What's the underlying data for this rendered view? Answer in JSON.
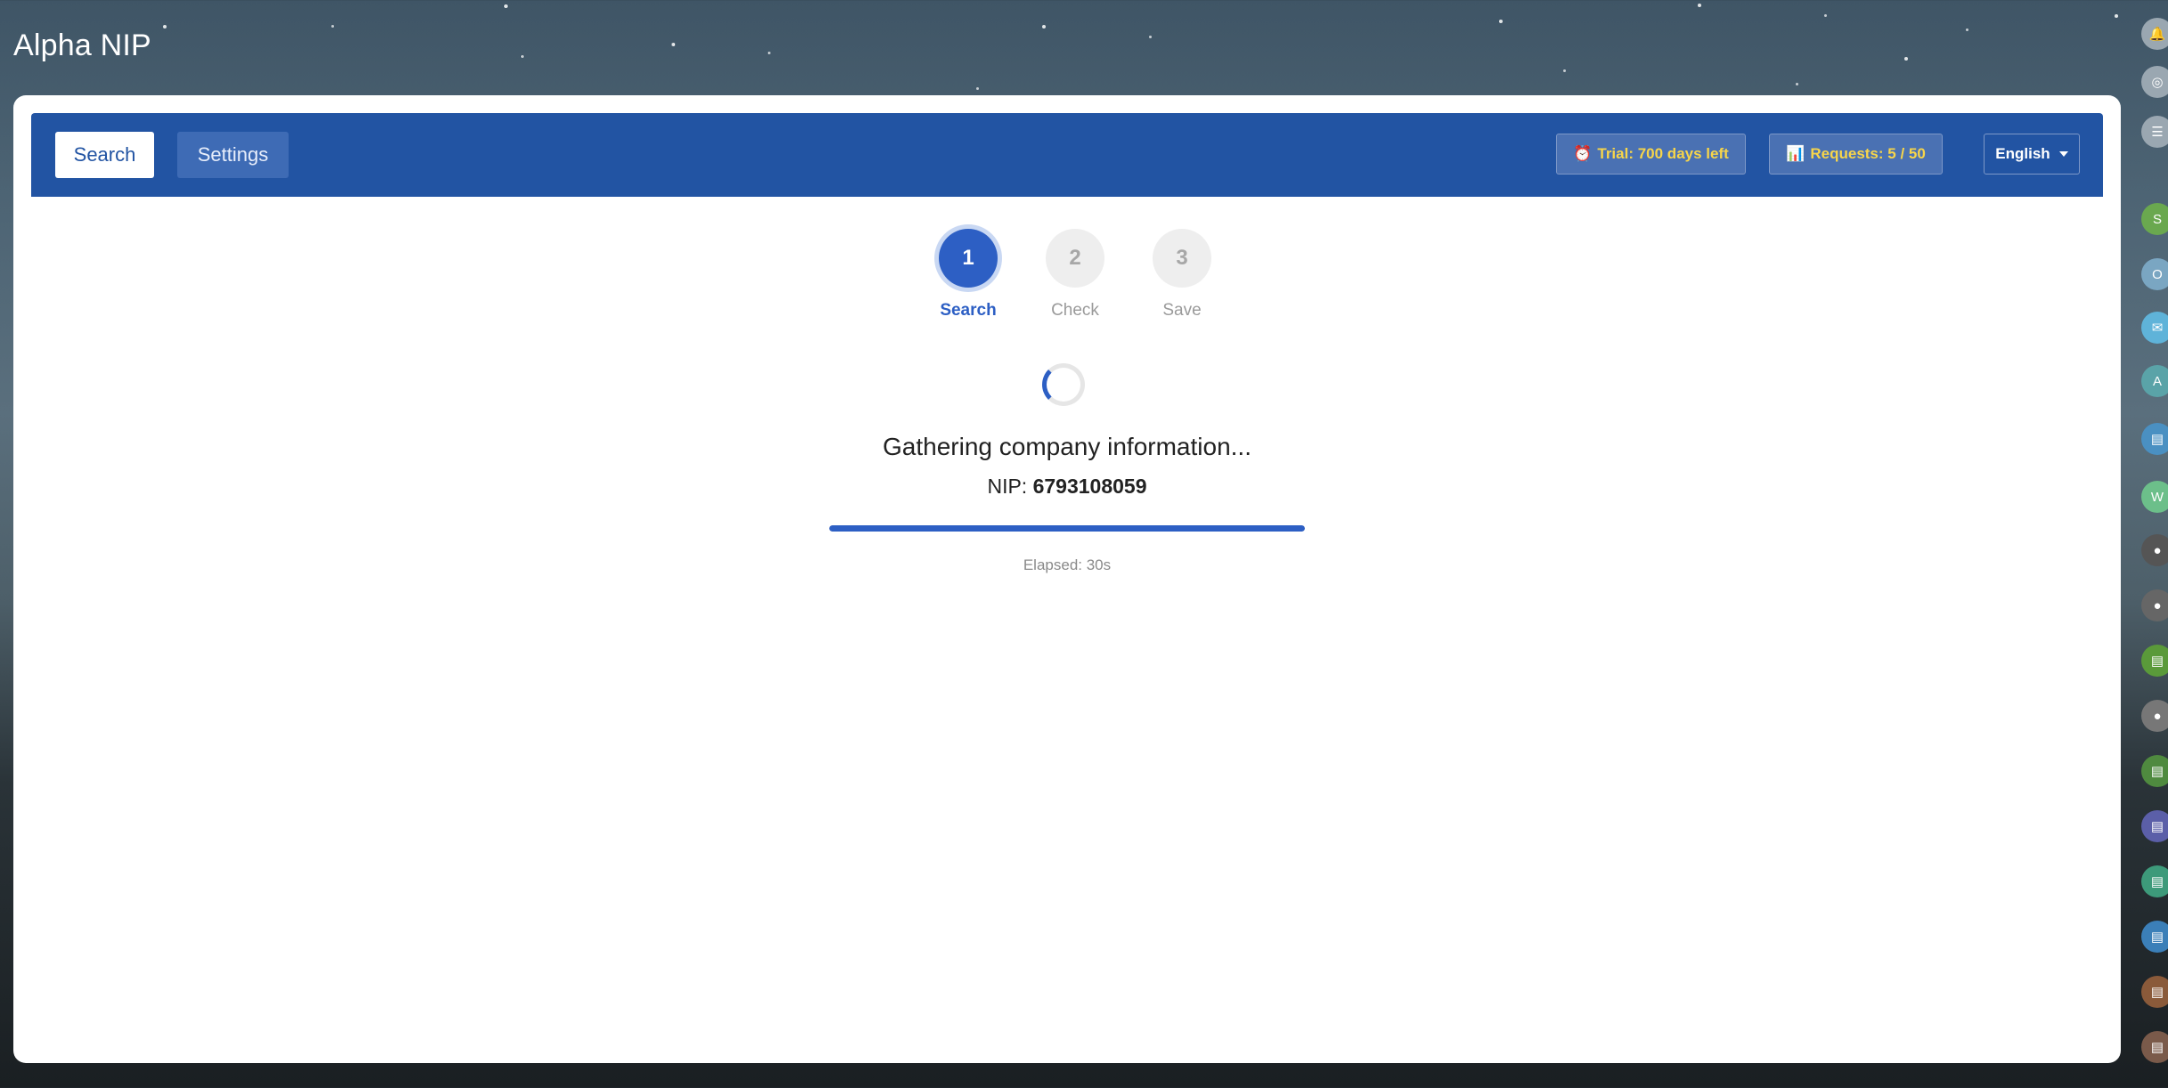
{
  "app": {
    "title": "Alpha NIP"
  },
  "tabs": [
    {
      "label": "Search",
      "active": true
    },
    {
      "label": "Settings",
      "active": false
    }
  ],
  "badges": {
    "trial_icon": "alarm-clock-icon",
    "trial": "Trial: 700 days left",
    "requests_icon": "bar-chart-icon",
    "requests": "Requests: 5 / 50"
  },
  "language": {
    "selected": "English"
  },
  "steps": [
    {
      "number": "1",
      "label": "Search",
      "state": "active"
    },
    {
      "number": "2",
      "label": "Check",
      "state": "todo"
    },
    {
      "number": "3",
      "label": "Save",
      "state": "todo"
    }
  ],
  "loading": {
    "message": "Gathering company information...",
    "nip_label": "NIP:",
    "nip_value": "6793108059",
    "progress": 1.0,
    "elapsed": "Elapsed: 30s"
  },
  "colors": {
    "primary": "#2254a3",
    "accent": "#2d5fc4",
    "badge_text": "#f7d54a"
  }
}
